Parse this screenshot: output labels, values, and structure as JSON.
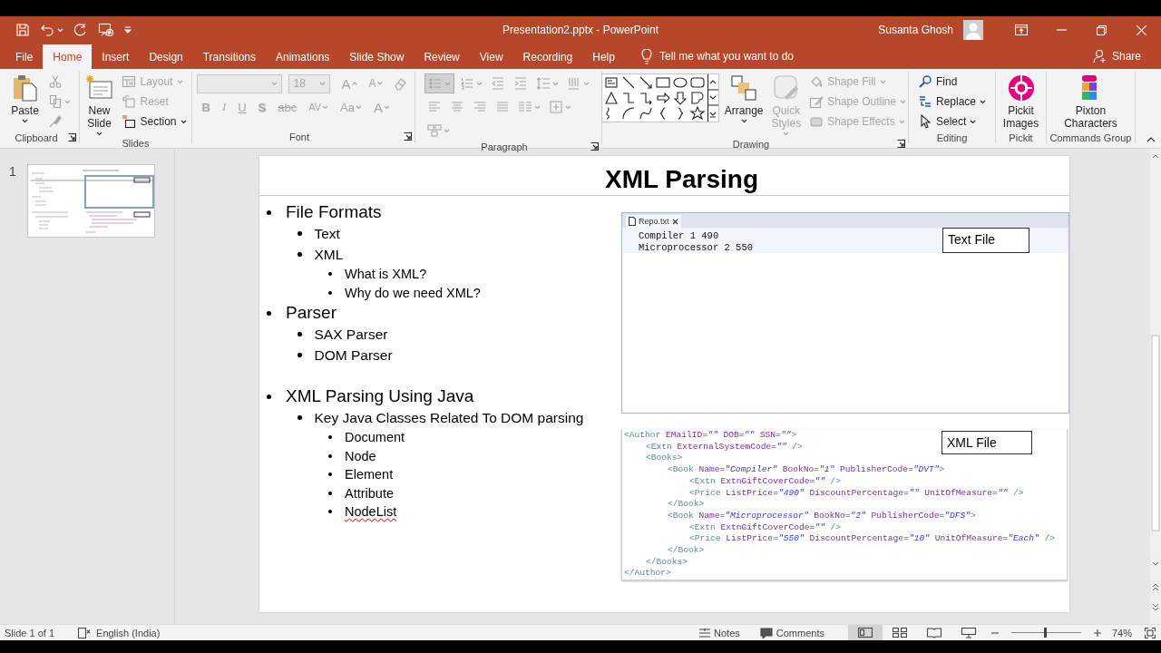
{
  "title_bar": {
    "document_title": "Presentation2.pptx - PowerPoint",
    "user_name": "Susanta Ghosh"
  },
  "tabs": [
    {
      "label": "File",
      "selected": false
    },
    {
      "label": "Home",
      "selected": true
    },
    {
      "label": "Insert",
      "selected": false
    },
    {
      "label": "Design",
      "selected": false
    },
    {
      "label": "Transitions",
      "selected": false
    },
    {
      "label": "Animations",
      "selected": false
    },
    {
      "label": "Slide Show",
      "selected": false
    },
    {
      "label": "Review",
      "selected": false
    },
    {
      "label": "View",
      "selected": false
    },
    {
      "label": "Recording",
      "selected": false
    },
    {
      "label": "Help",
      "selected": false
    }
  ],
  "tell_me": "Tell me what you want to do",
  "share": "Share",
  "ribbon": {
    "groups": [
      {
        "name": "Clipboard",
        "items": [
          {
            "kind": "large",
            "label": "Paste",
            "disabled": false
          },
          {
            "kind": "icon",
            "disabled": true
          },
          {
            "kind": "icon",
            "disabled": true
          },
          {
            "kind": "icon",
            "disabled": true
          }
        ]
      },
      {
        "name": "Slides",
        "items": [
          {
            "kind": "large",
            "label": "New Slide",
            "disabled": false
          },
          {
            "kind": "small",
            "label": "Layout",
            "disabled": true
          },
          {
            "kind": "small",
            "label": "Reset",
            "disabled": true
          },
          {
            "kind": "small",
            "label": "Section",
            "disabled": false
          }
        ]
      },
      {
        "name": "Font",
        "toolbars": [
          [
            {
              "kind": "field",
              "disabled": true
            },
            {
              "kind": "field",
              "value": "18",
              "disabled": true
            },
            {
              "kind": "glyph",
              "label": "A",
              "disabled": true
            },
            {
              "kind": "glyph",
              "label": "A",
              "disabled": true
            },
            {
              "kind": "icon",
              "disabled": true
            }
          ],
          [
            {
              "kind": "glyph",
              "label": "B",
              "disabled": true
            },
            {
              "kind": "glyph",
              "label": "I",
              "disabled": true
            },
            {
              "kind": "glyph",
              "label": "U",
              "disabled": true
            },
            {
              "kind": "glyph",
              "label": "S",
              "disabled": true
            },
            {
              "kind": "glyph",
              "label": "abc",
              "disabled": true
            },
            {
              "kind": "glyph",
              "label": "AV",
              "disabled": true
            },
            {
              "kind": "glyph",
              "label": "Aa",
              "disabled": true
            },
            {
              "kind": "glyph",
              "label": "A",
              "disabled": true
            }
          ]
        ]
      },
      {
        "name": "Paragraph",
        "toolbars": [
          [
            {
              "kind": "icon",
              "disabled": true
            },
            {
              "kind": "icon",
              "disabled": true
            },
            {
              "kind": "icon",
              "disabled": true
            },
            {
              "kind": "icon",
              "disabled": true
            },
            {
              "kind": "icon",
              "disabled": true
            },
            {
              "kind": "icon",
              "disabled": true
            }
          ],
          [
            {
              "kind": "icon",
              "disabled": true
            },
            {
              "kind": "icon",
              "disabled": true
            },
            {
              "kind": "icon",
              "disabled": true
            },
            {
              "kind": "icon",
              "disabled": true
            },
            {
              "kind": "icon",
              "disabled": true
            },
            {
              "kind": "icon",
              "disabled": true
            }
          ],
          [
            {
              "kind": "icon",
              "disabled": true
            }
          ]
        ]
      },
      {
        "name": "Drawing",
        "items": [
          {
            "kind": "gallery",
            "disabled": false
          },
          {
            "kind": "large",
            "label": "Arrange",
            "disabled": false
          },
          {
            "kind": "large",
            "label": "Quick Styles",
            "disabled": true
          },
          {
            "kind": "small",
            "label": "Shape Fill",
            "disabled": true
          },
          {
            "kind": "small",
            "label": "Shape Outline",
            "disabled": true
          },
          {
            "kind": "small",
            "label": "Shape Effects",
            "disabled": true
          }
        ]
      },
      {
        "name": "Editing",
        "items": [
          {
            "kind": "small",
            "label": "Find",
            "disabled": false
          },
          {
            "kind": "small",
            "label": "Replace",
            "disabled": false
          },
          {
            "kind": "small",
            "label": "Select",
            "disabled": false
          }
        ]
      },
      {
        "name": "Pickit",
        "items": [
          {
            "kind": "large",
            "label": "Pickit Images",
            "disabled": false
          }
        ]
      },
      {
        "name": "Commands Group",
        "items": [
          {
            "kind": "large",
            "label": "Pixton Characters",
            "disabled": false
          }
        ]
      }
    ]
  },
  "thumbnails": [
    {
      "number": "1"
    }
  ],
  "slide": {
    "title": "XML Parsing",
    "bullets": [
      {
        "text": "File Formats",
        "misspelled": false,
        "children": [
          {
            "text": "Text",
            "misspelled": false
          },
          {
            "text": "XML",
            "misspelled": false,
            "children": [
              {
                "text": "What is XML?",
                "misspelled": false
              },
              {
                "text": "Why do we need XML?",
                "misspelled": false
              }
            ]
          }
        ]
      },
      {
        "text": "Parser",
        "misspelled": false,
        "children": [
          {
            "text": "SAX Parser",
            "misspelled": false
          },
          {
            "text": "DOM Parser",
            "misspelled": false
          }
        ]
      },
      {
        "text": "XML Parsing Using Java",
        "misspelled": false,
        "children": [
          {
            "text": "Key Java Classes Related To DOM parsing",
            "misspelled": false,
            "children": [
              {
                "text": "Document",
                "misspelled": false
              },
              {
                "text": "Node",
                "misspelled": false
              },
              {
                "text": "Element",
                "misspelled": false
              },
              {
                "text": "Attribute",
                "misspelled": false
              },
              {
                "text": "NodeList",
                "misspelled": true
              }
            ]
          }
        ]
      }
    ],
    "text_file": {
      "tab": "Repo.txt",
      "lines": [
        "Compiler 1 490",
        "Microprocessor 2 550"
      ],
      "label": "Text File"
    },
    "xml_file": {
      "label": "XML File",
      "lines": [
        {
          "text": "<Author EMailID=\"\" DOB=\"\" SSN=\"\">",
          "children": [
            {
              "text": "<Extn ExternalSystemCode=\"\" />"
            },
            {
              "text": "<Books>",
              "children": [
                {
                  "text": "<Book Name=\"Compiler\" BookNo=\"1\" PublisherCode=\"DVT\">",
                  "children": [
                    {
                      "text": "<Extn ExtnGiftCoverCode=\"\" />"
                    },
                    {
                      "text": "<Price ListPrice=\"490\" DiscountPercentage=\"\" UnitOfMeasure=\"\" />"
                    }
                  ]
                },
                {
                  "text": "</Book>"
                },
                {
                  "text": "<Book Name=\"Microprocessor\" BookNo=\"2\" PublisherCode=\"DFS\">",
                  "children": [
                    {
                      "text": "<Extn ExtnGiftCoverCode=\"\" />"
                    },
                    {
                      "text": "<Price ListPrice=\"550\" DiscountPercentage=\"10\" UnitOfMeasure=\"Each\" />"
                    }
                  ]
                },
                {
                  "text": "</Book>"
                }
              ]
            },
            {
              "text": "</Books>"
            }
          ]
        },
        {
          "text": "</Author>"
        }
      ]
    }
  },
  "status_bar": {
    "slide_indicator": "Slide 1 of 1",
    "language": "English (India)",
    "notes": "Notes",
    "comments": "Comments",
    "views": [
      {
        "selected": true
      },
      {
        "selected": false
      },
      {
        "selected": false
      },
      {
        "selected": false
      }
    ],
    "zoom": {
      "level": 0.48
    },
    "zoom_percent": "74%"
  }
}
